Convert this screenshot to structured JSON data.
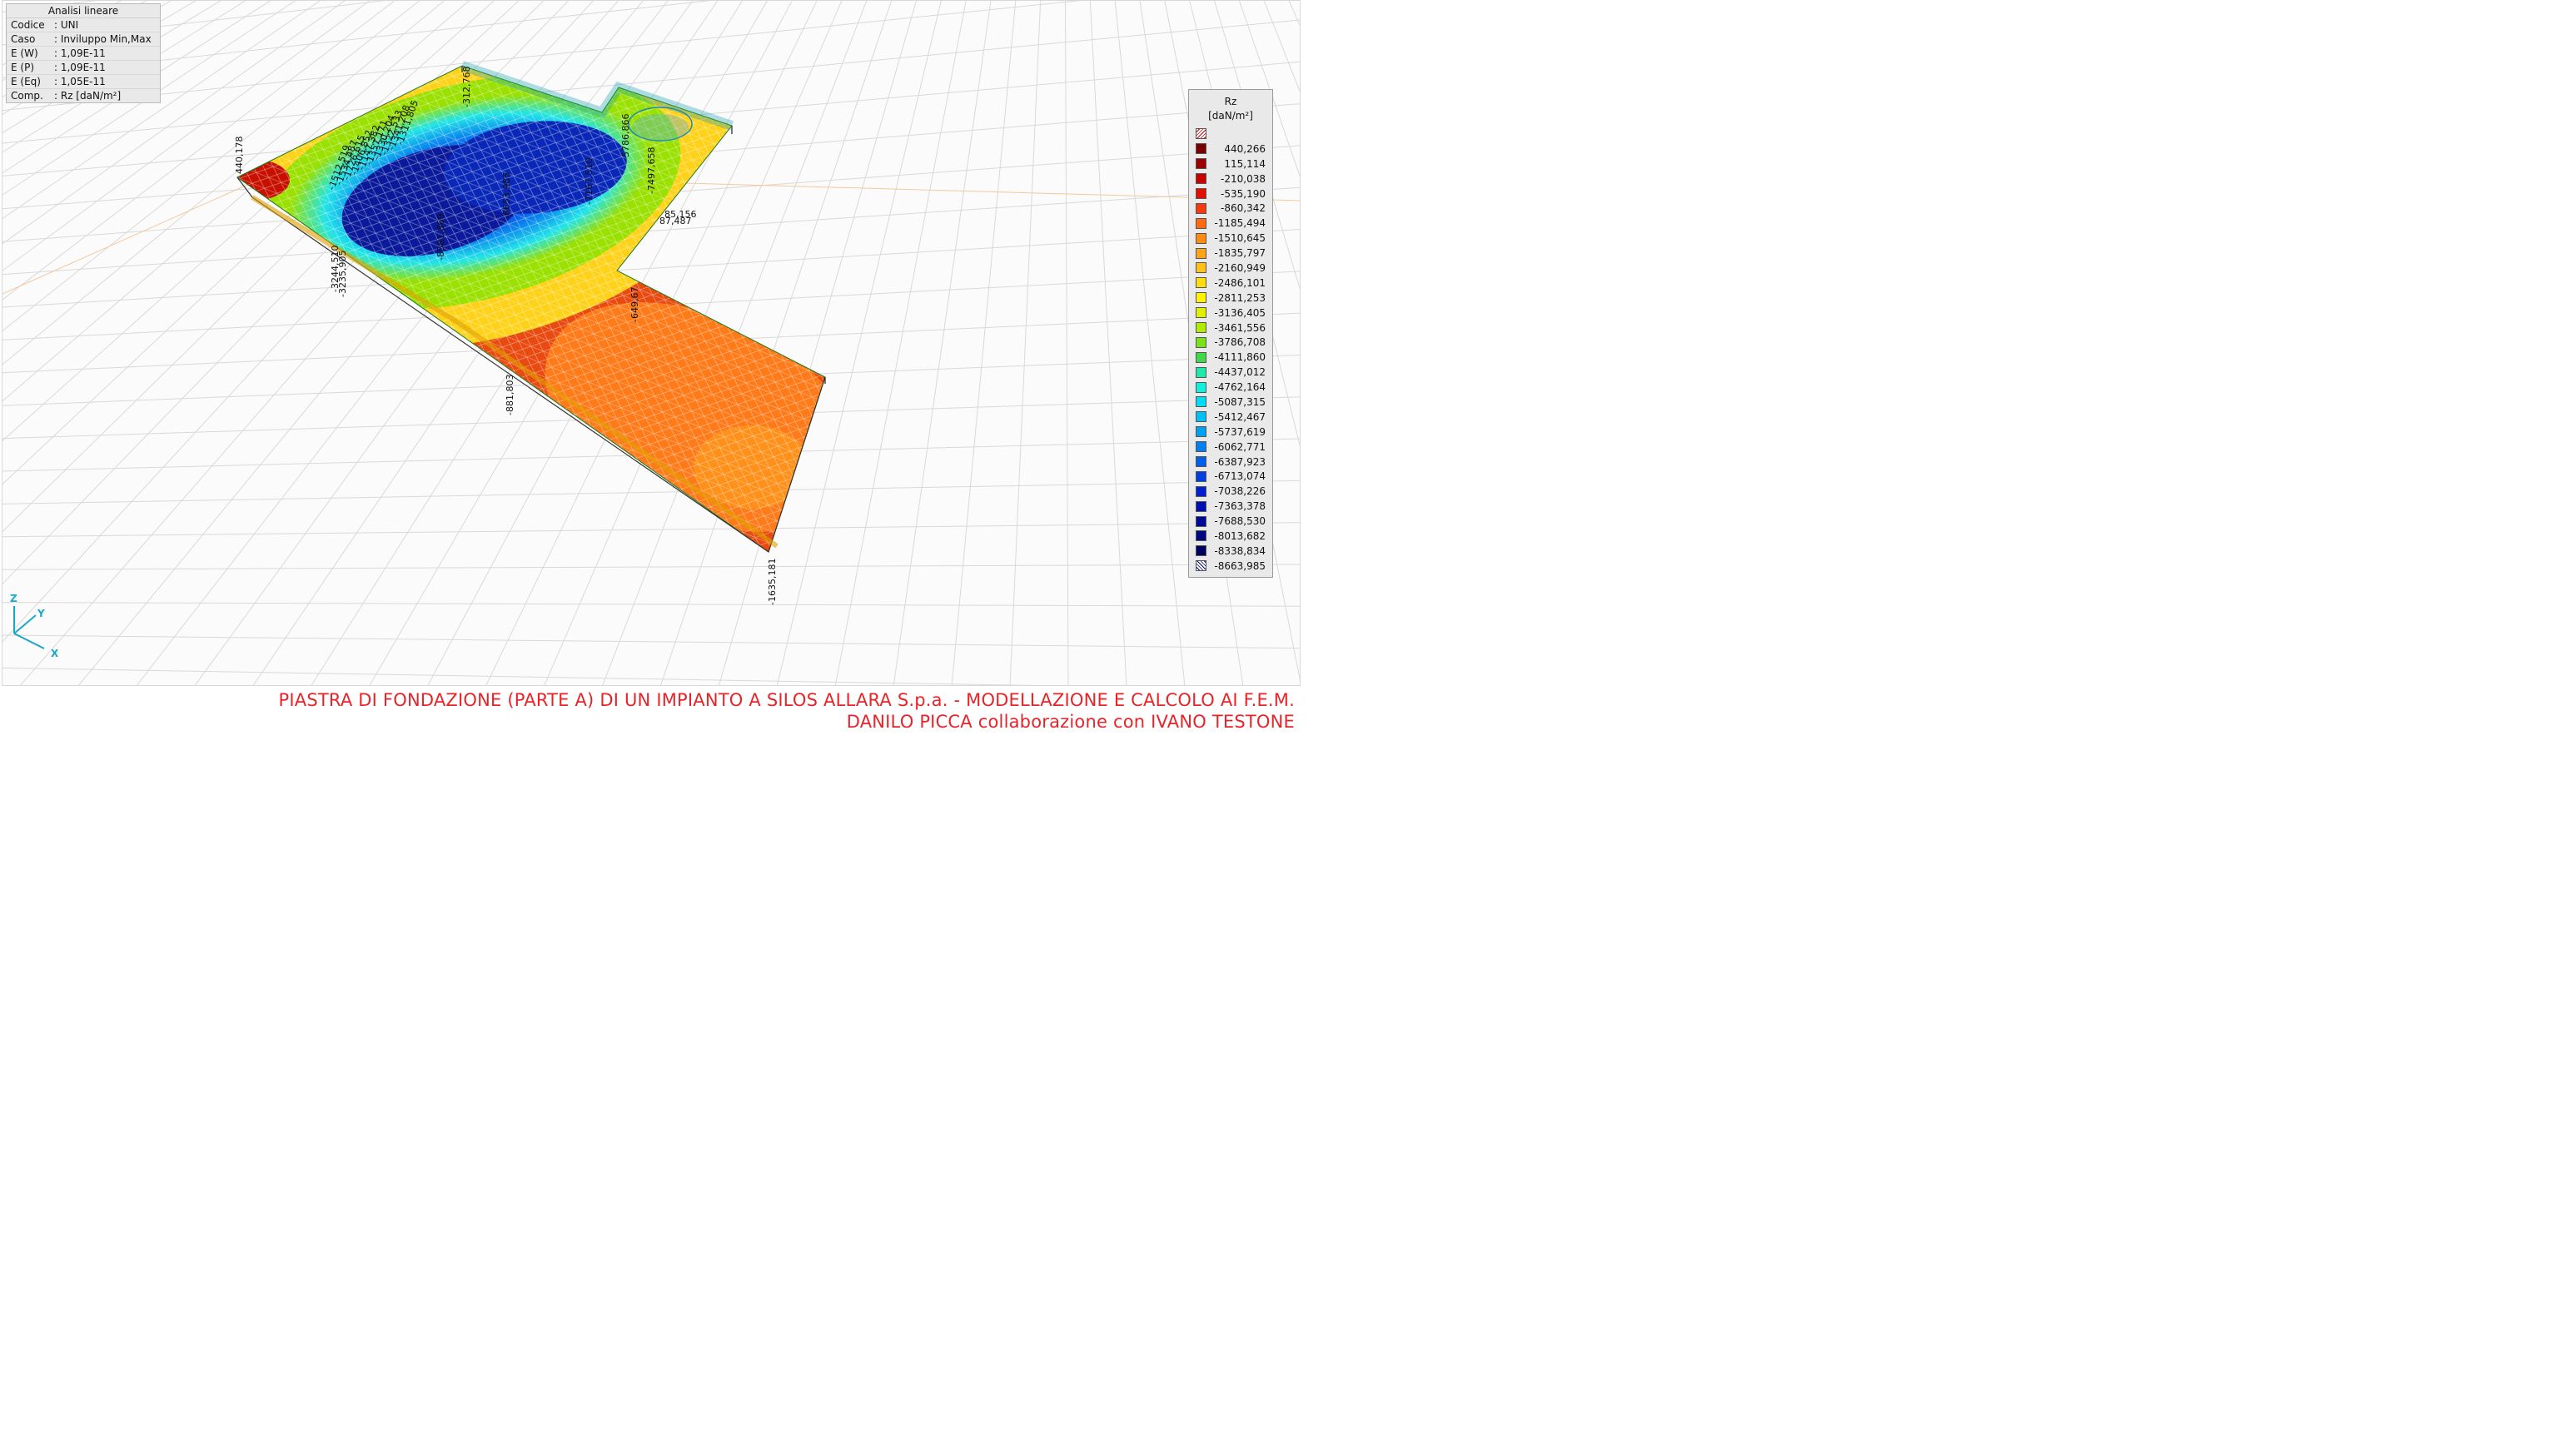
{
  "info_panel": {
    "title": "Analisi lineare",
    "rows": [
      {
        "key": "Codice",
        "value": ": UNI"
      },
      {
        "key": "Caso",
        "value": ": Inviluppo Min,Max"
      },
      {
        "key": "E (W)",
        "value": ": 1,09E-11"
      },
      {
        "key": "E (P)",
        "value": ": 1,09E-11"
      },
      {
        "key": "E (Eq)",
        "value": ": 1,05E-11"
      },
      {
        "key": "Comp.",
        "value": ": Rz [daN/m²]"
      }
    ]
  },
  "legend": {
    "title": "Rz",
    "unit": "[daN/m²]",
    "top_hatch_color": "#c00000",
    "bottom_hatch_color": "#000088",
    "items": [
      {
        "value": "440,266",
        "color": "#7a0000"
      },
      {
        "value": "115,114",
        "color": "#9c0000"
      },
      {
        "value": "-210,038",
        "color": "#c80000"
      },
      {
        "value": "-535,190",
        "color": "#e11000"
      },
      {
        "value": "-860,342",
        "color": "#f53a10"
      },
      {
        "value": "-1185,494",
        "color": "#ff6a10"
      },
      {
        "value": "-1510,645",
        "color": "#ff8a12"
      },
      {
        "value": "-1835,797",
        "color": "#ffa418"
      },
      {
        "value": "-2160,949",
        "color": "#ffc018"
      },
      {
        "value": "-2486,101",
        "color": "#ffdc10"
      },
      {
        "value": "-2811,253",
        "color": "#fff200"
      },
      {
        "value": "-3136,405",
        "color": "#e0f000"
      },
      {
        "value": "-3461,556",
        "color": "#b0ec00"
      },
      {
        "value": "-3786,708",
        "color": "#7be21a"
      },
      {
        "value": "-4111,860",
        "color": "#3ed84a"
      },
      {
        "value": "-4437,012",
        "color": "#20e8a8"
      },
      {
        "value": "-4762,164",
        "color": "#10f0dc"
      },
      {
        "value": "-5087,315",
        "color": "#00dcf8"
      },
      {
        "value": "-5412,467",
        "color": "#00c0f8"
      },
      {
        "value": "-5737,619",
        "color": "#00a0f0"
      },
      {
        "value": "-6062,771",
        "color": "#0080f0"
      },
      {
        "value": "-6387,923",
        "color": "#0060e8"
      },
      {
        "value": "-6713,074",
        "color": "#0040e0"
      },
      {
        "value": "-7038,226",
        "color": "#0020d0"
      },
      {
        "value": "-7363,378",
        "color": "#0010b0"
      },
      {
        "value": "-7688,530",
        "color": "#000898"
      },
      {
        "value": "-8013,682",
        "color": "#000880"
      },
      {
        "value": "-8338,834",
        "color": "#000060"
      },
      {
        "value": "-8663,985",
        "color": null
      }
    ]
  },
  "plot_labels": [
    {
      "text": "440,178"
    },
    {
      "text": "-312,768"
    },
    {
      "text": "-1512,519"
    },
    {
      "text": "-1534,487"
    },
    {
      "text": "-1726,615"
    },
    {
      "text": "-1406,852"
    },
    {
      "text": "-1147,382"
    },
    {
      "text": "-1357,171"
    },
    {
      "text": "-1330,204"
    },
    {
      "text": "-1322,533"
    },
    {
      "text": "-1341,208"
    },
    {
      "text": "-1311,805"
    },
    {
      "text": "-8653,985"
    },
    {
      "text": "-8581,869"
    },
    {
      "text": "-7167,510"
    },
    {
      "text": "-5786,866"
    },
    {
      "text": "-7497,658"
    },
    {
      "text": "85,156"
    },
    {
      "text": "87,487"
    },
    {
      "text": "-3244,510"
    },
    {
      "text": "-3235,905"
    },
    {
      "text": "-649,67"
    },
    {
      "text": "-881,803"
    },
    {
      "text": "-1635,181"
    }
  ],
  "axes": {
    "z": "Z",
    "y": "Y",
    "x": "X"
  },
  "colors": {
    "axis": "#1aa8c8",
    "footer": "#e8242a",
    "outline": "#1a7a1a"
  },
  "footer": {
    "line1": "PIASTRA DI FONDAZIONE (PARTE A) DI UN IMPIANTO A SILOS ALLARA S.p.a. - MODELLAZIONE E CALCOLO AI F.E.M.",
    "line2": "DANILO PICCA collaborazione con IVANO TESTONE"
  }
}
